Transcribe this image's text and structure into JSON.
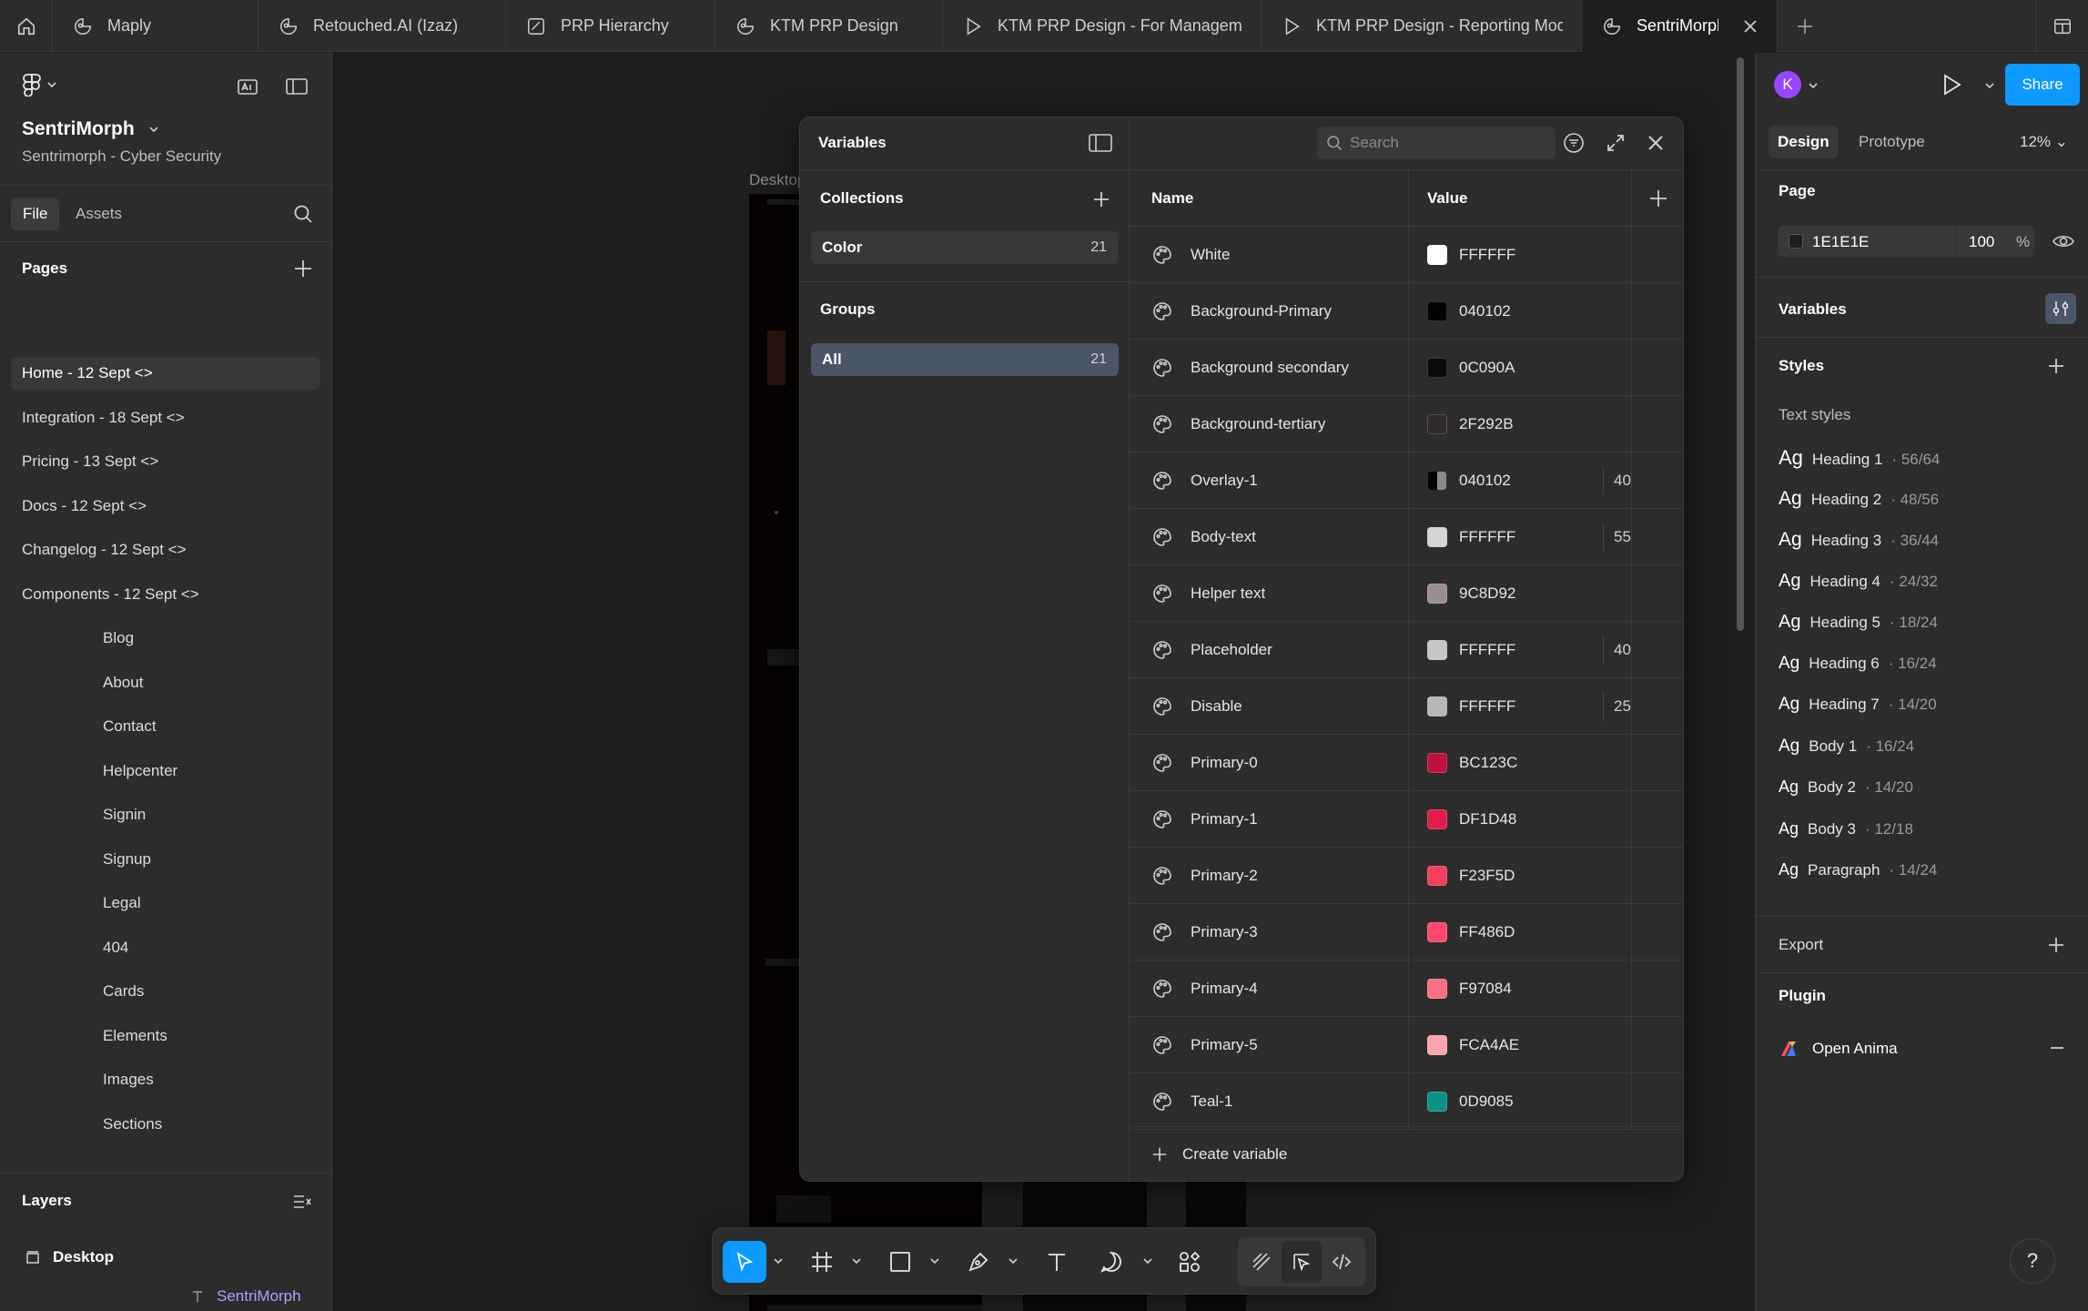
{
  "tabs": [
    {
      "label": "Maply",
      "icon": "figma-file-icon"
    },
    {
      "label": "Retouched.AI (Izaz)",
      "icon": "figma-file-icon"
    },
    {
      "label": "PRP Hierarchy",
      "icon": "figjam-icon"
    },
    {
      "label": "KTM PRP Design",
      "icon": "figma-file-icon"
    },
    {
      "label": "KTM PRP Design - For Managemen",
      "icon": "play-icon"
    },
    {
      "label": "KTM PRP Design - Reporting Modu",
      "icon": "play-icon"
    },
    {
      "label": "SentriMorph",
      "icon": "figma-file-icon",
      "active": true
    }
  ],
  "left": {
    "file_title": "SentriMorph",
    "file_subtitle": "Sentrimorph - Cyber Security",
    "tab_file": "File",
    "tab_assets": "Assets",
    "pages_label": "Pages",
    "pages": [
      {
        "label": "Home - 12 Sept  <>",
        "selected": true
      },
      {
        "label": "Integration - 18 Sept  <>"
      },
      {
        "label": "Pricing - 13 Sept  <>"
      },
      {
        "label": "Docs - 12 Sept  <>"
      },
      {
        "label": "Changelog - 12 Sept  <>"
      },
      {
        "label": "Components - 12 Sept  <>"
      },
      {
        "label": "Blog",
        "indent": true
      },
      {
        "label": "About",
        "indent": true
      },
      {
        "label": "Contact",
        "indent": true
      },
      {
        "label": "Helpcenter",
        "indent": true
      },
      {
        "label": "Signin",
        "indent": true
      },
      {
        "label": "Signup",
        "indent": true
      },
      {
        "label": "Legal",
        "indent": true
      },
      {
        "label": "404",
        "indent": true
      },
      {
        "label": "Cards",
        "indent": true
      },
      {
        "label": "Elements",
        "indent": true
      },
      {
        "label": "Images",
        "indent": true
      },
      {
        "label": "Sections",
        "indent": true
      }
    ],
    "layers_label": "Layers",
    "layer_desktop": "Desktop",
    "layer_text": "SentriMorph"
  },
  "canvas": {
    "frame_label": "Desktop"
  },
  "variables": {
    "title": "Variables",
    "collections_label": "Collections",
    "collection": {
      "name": "Color",
      "count": "21"
    },
    "groups_label": "Groups",
    "group": {
      "name": "All",
      "count": "21"
    },
    "search_placeholder": "Search",
    "col_name": "Name",
    "col_value": "Value",
    "rows": [
      {
        "name": "White",
        "hex": "FFFFFF",
        "color": "#FFFFFF",
        "opacity": ""
      },
      {
        "name": "Background-Primary",
        "hex": "040102",
        "color": "#040102",
        "opacity": ""
      },
      {
        "name": "Background secondary",
        "hex": "0C090A",
        "color": "#0C090A",
        "opacity": ""
      },
      {
        "name": "Background-tertiary",
        "hex": "2F292B",
        "color": "#2F292B",
        "opacity": ""
      },
      {
        "name": "Overlay-1",
        "hex": "040102",
        "color": "#040102",
        "opacity": "40",
        "partial": true
      },
      {
        "name": "Body-text",
        "hex": "FFFFFF",
        "color": "#FFFFFF",
        "opacity": "55"
      },
      {
        "name": "Helper text",
        "hex": "9C8D92",
        "color": "#9C8D92",
        "opacity": ""
      },
      {
        "name": "Placeholder",
        "hex": "FFFFFF",
        "color": "#FFFFFF",
        "opacity": "40"
      },
      {
        "name": "Disable",
        "hex": "FFFFFF",
        "color": "#FFFFFF",
        "opacity": "25"
      },
      {
        "name": "Primary-0",
        "hex": "BC123C",
        "color": "#BC123C",
        "opacity": ""
      },
      {
        "name": "Primary-1",
        "hex": "DF1D48",
        "color": "#DF1D48",
        "opacity": ""
      },
      {
        "name": "Primary-2",
        "hex": "F23F5D",
        "color": "#F23F5D",
        "opacity": ""
      },
      {
        "name": "Primary-3",
        "hex": "FF486D",
        "color": "#FF486D",
        "opacity": ""
      },
      {
        "name": "Primary-4",
        "hex": "F97084",
        "color": "#F97084",
        "opacity": ""
      },
      {
        "name": "Primary-5",
        "hex": "FCA4AE",
        "color": "#FCA4AE",
        "opacity": ""
      },
      {
        "name": "Teal-1",
        "hex": "0D9085",
        "color": "#0D9085",
        "opacity": ""
      }
    ],
    "create_label": "Create variable"
  },
  "right": {
    "avatar_letter": "K",
    "share_label": "Share",
    "tab_design": "Design",
    "tab_prototype": "Prototype",
    "zoom": "12%",
    "page_label": "Page",
    "page_color": "1E1E1E",
    "page_opacity": "100",
    "page_opacity_unit": "%",
    "variables_label": "Variables",
    "styles_label": "Styles",
    "text_styles_label": "Text styles",
    "text_styles": [
      {
        "name": "Heading 1",
        "size": "· 56/64"
      },
      {
        "name": "Heading 2",
        "size": "· 48/56"
      },
      {
        "name": "Heading 3",
        "size": "· 36/44"
      },
      {
        "name": "Heading 4",
        "size": "· 24/32"
      },
      {
        "name": "Heading 5",
        "size": "· 18/24"
      },
      {
        "name": "Heading 6",
        "size": "· 16/24"
      },
      {
        "name": "Heading 7",
        "size": "· 14/20"
      },
      {
        "name": "Body 1",
        "size": "· 16/24"
      },
      {
        "name": "Body 2",
        "size": "· 14/20"
      },
      {
        "name": "Body 3",
        "size": "· 12/18"
      },
      {
        "name": "Paragraph",
        "size": "· 14/24"
      }
    ],
    "ag": "Ag",
    "export_label": "Export",
    "plugin_label": "Plugin",
    "plugin_name": "Open Anima"
  },
  "help": "?"
}
